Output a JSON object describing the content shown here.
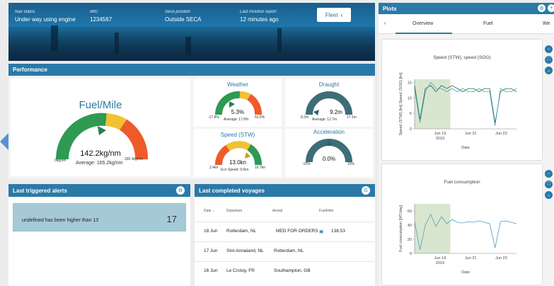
{
  "header": {
    "status_label": "Nav status",
    "status_value": "Under way using engine",
    "imo_label": "IMO",
    "imo_value": "1234567",
    "seca_label": "Seca position",
    "seca_value": "Outside SECA",
    "report_label": "Last Position report",
    "report_value": "12 minutes ago",
    "fleet_label": "Fleet"
  },
  "performance": {
    "title": "Performance",
    "fuel_mile": {
      "title": "Fuel/Mile",
      "value": "142.2kg/nm",
      "average": "Average: 165.2kg/nm",
      "min": "0kg/nm",
      "max": "330.3kg/nm",
      "level": 0.43
    },
    "weather": {
      "title": "Weather",
      "value": "5.3%",
      "average": "Average: 17.8%",
      "min": "-17.8%",
      "max": "53.5%",
      "level": 0.32
    },
    "draught": {
      "title": "Draught",
      "value": "9.2m",
      "average": "Average: 12.7m",
      "min": "8.2m",
      "max": "17.1m",
      "level": 0.15
    },
    "speed": {
      "title": "Speed (STW)",
      "value": "13.0kn",
      "average": "Eco Speed: 9.5kn",
      "min": "2.4kn",
      "max": "16.7kn",
      "level": 0.82
    },
    "acceleration": {
      "title": "Acceleration",
      "value": "0.0%",
      "min": "-15%",
      "max": "15%",
      "level": 0.5
    }
  },
  "alerts": {
    "title": "Last triggered alerts",
    "items": [
      {
        "text": "undefined has been higher than 13",
        "count": "17"
      }
    ]
  },
  "voyages": {
    "title": "Last completed voyages",
    "columns": [
      "Date",
      "Departure",
      "Arrival",
      "Fuel/mile"
    ],
    "rows": [
      {
        "date": "18 Jun",
        "departure": "Rotterdam, NL",
        "arrival": "MED FOR ORDERS",
        "fuel": "138.53"
      },
      {
        "date": "17 Jun",
        "departure": "Sint-Annaland, NL",
        "arrival": "Rotterdam, NL",
        "fuel": ""
      },
      {
        "date": "16 Jun",
        "departure": "Le Crotoy, FR",
        "arrival": "Southampton, GB",
        "fuel": ""
      }
    ]
  },
  "plots": {
    "title": "Plots",
    "tabs": [
      "Overview",
      "Fuel",
      "We"
    ],
    "colors": {
      "accent": "#2a7aa8",
      "line": "#4a9fc9",
      "line_dark": "#1d6b3a",
      "shade": "#d9e6cf"
    }
  },
  "chart_data": [
    {
      "type": "line",
      "title": "Speed (STW), speed (SOG)",
      "xlabel": "Date",
      "ylabel": "Speed (STW) [kn] Speed (SOG) [kn]",
      "x_ticks": [
        "Jun 19 2019",
        "Jun 21",
        "Jun 23"
      ],
      "y_ticks": [
        0,
        5,
        10,
        15
      ],
      "ylim": [
        0,
        16
      ],
      "series": [
        {
          "name": "Speed (STW)",
          "values": [
            14,
            3,
            13,
            14,
            12,
            14,
            13,
            14,
            13,
            12,
            13,
            13,
            12,
            13,
            13,
            2,
            12,
            13,
            13,
            12
          ]
        },
        {
          "name": "Speed (SOG)",
          "values": [
            13,
            2,
            12,
            15,
            13,
            13,
            12,
            13,
            12,
            13,
            12,
            12,
            13,
            12,
            12,
            1,
            13,
            12,
            12,
            13
          ]
        }
      ]
    },
    {
      "type": "line",
      "title": "Fuel consumption",
      "xlabel": "Date",
      "ylabel": "Fuel consumption [MT/day]",
      "x_ticks": [
        "Jun 19 2019",
        "Jun 21",
        "Jun 23"
      ],
      "y_ticks": [
        0,
        20,
        40,
        60
      ],
      "ylim": [
        0,
        70
      ],
      "series": [
        {
          "name": "Fuel consumption",
          "values": [
            45,
            5,
            40,
            55,
            38,
            52,
            42,
            48,
            44,
            43,
            45,
            44,
            46,
            44,
            42,
            8,
            45,
            46,
            44,
            42
          ]
        }
      ]
    }
  ]
}
